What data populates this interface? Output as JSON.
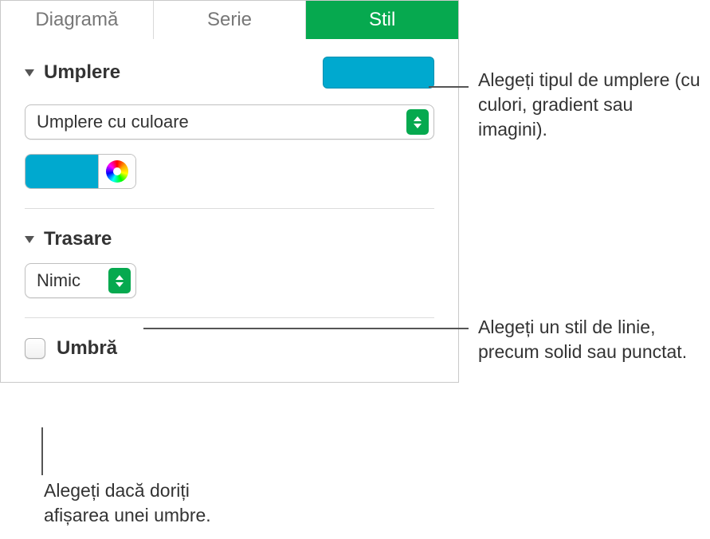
{
  "tabs": {
    "chart": "Diagramă",
    "series": "Serie",
    "style": "Stil"
  },
  "fill": {
    "title": "Umplere",
    "popup_label": "Umplere cu culoare",
    "swatch_color": "#00a9cf"
  },
  "stroke": {
    "title": "Trasare",
    "popup_label": "Nimic"
  },
  "shadow": {
    "label": "Umbră"
  },
  "callouts": {
    "fill": "Alegeți tipul de umplere (cu culori, gradient sau imagini).",
    "stroke": "Alegeți un stil de linie, precum solid sau punctat.",
    "shadow": "Alegeți dacă doriți afișarea unei umbre."
  }
}
